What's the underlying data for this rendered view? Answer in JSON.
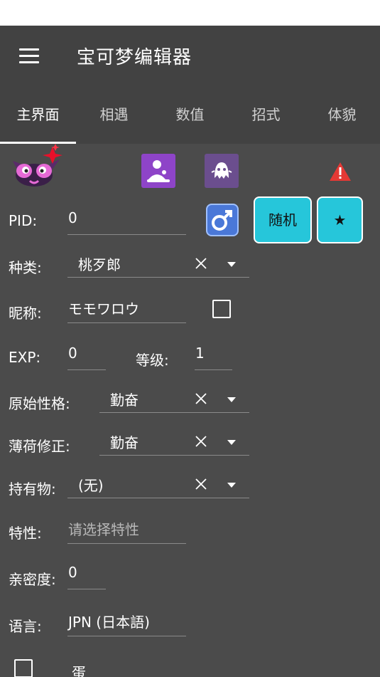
{
  "app": {
    "title": "宝可梦编辑器"
  },
  "tabs": [
    {
      "label": "主界面",
      "active": true
    },
    {
      "label": "相遇"
    },
    {
      "label": "数值"
    },
    {
      "label": "招式"
    },
    {
      "label": "体貌"
    }
  ],
  "header": {
    "male_symbol": "♂",
    "random_button": "随机",
    "star_button": "★"
  },
  "form": {
    "pid": {
      "label": "PID:",
      "value": "0"
    },
    "species": {
      "label": "种类:",
      "value": "桃歹郎"
    },
    "nickname": {
      "label": "昵称:",
      "value": "モモワロウ"
    },
    "exp": {
      "label": "EXP:",
      "value": "0"
    },
    "level": {
      "label": "等级:",
      "value": "1"
    },
    "nature": {
      "label": "原始性格:",
      "value": "勤奋"
    },
    "mint_nature": {
      "label": "薄荷修正:",
      "value": "勤奋"
    },
    "held_item": {
      "label": "持有物:",
      "value": "(无)"
    },
    "ability": {
      "label": "特性:",
      "placeholder": "请选择特性"
    },
    "friendship": {
      "label": "亲密度:",
      "value": "0"
    },
    "language": {
      "label": "语言:",
      "value": "JPN (日本語)"
    },
    "egg": {
      "label": "蛋"
    }
  },
  "colors": {
    "accent": "#26c6da",
    "appbar": "#424242",
    "content_bg": "#4b4b4b",
    "warning": "#e53935",
    "type_tile_purple": "#8e44c8",
    "type_tile_ghost": "#6b4e8e",
    "gender_male": "#4a78d8"
  }
}
